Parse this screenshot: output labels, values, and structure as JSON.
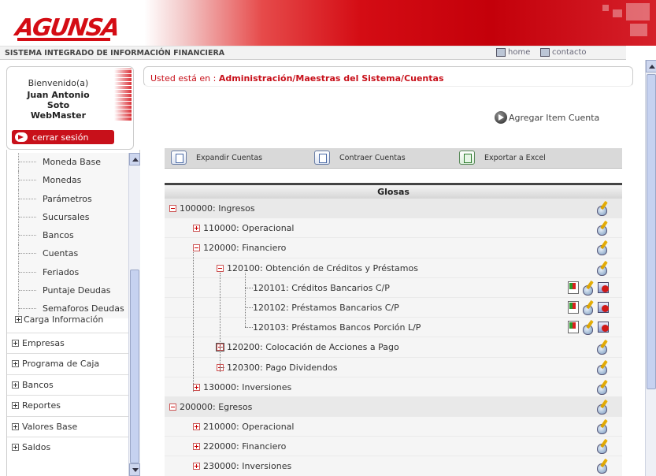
{
  "header": {
    "logo": "AGUNSA",
    "system_title": "SISTEMA INTEGRADO DE INFORMACIÓN FINANCIERA",
    "home_label": "home",
    "contact_label": "contacto"
  },
  "welcome": {
    "greeting": "Bienvenido(a)",
    "name": "Juan Antonio Soto",
    "role": "WebMaster",
    "logout_label": "cerrar sesión"
  },
  "sidebar": {
    "sub_items": [
      "Moneda Base",
      "Monedas",
      "Parámetros",
      "Sucursales",
      "Bancos",
      "Cuentas",
      "Feriados",
      "Puntaje Deudas",
      "Semaforos Deudas"
    ],
    "carga_label": "Carga Información",
    "menus": [
      "Empresas",
      "Programa de Caja",
      "Bancos",
      "Reportes",
      "Valores Base",
      "Saldos"
    ]
  },
  "breadcrumb": {
    "prefix": "Usted está en :",
    "path": "Administración/Maestras del Sistema/Cuentas"
  },
  "add_item_label": "Agregar Item Cuenta",
  "toolbar": {
    "expand_label": "Expandir Cuentas",
    "collapse_label": "Contraer Cuentas",
    "export_label": "Exportar a Excel"
  },
  "table": {
    "header": "Glosas",
    "rows": [
      {
        "label": "100000: Ingresos"
      },
      {
        "label": "110000: Operacional"
      },
      {
        "label": "120000: Financiero"
      },
      {
        "label": "120100: Obtención de Créditos y Préstamos"
      },
      {
        "label": "120101: Créditos Bancarios C/P"
      },
      {
        "label": "120102: Préstamos Bancarios C/P"
      },
      {
        "label": "120103: Préstamos Bancos Porción L/P"
      },
      {
        "label": "120200: Colocación de Acciones a Pago"
      },
      {
        "label": "120300: Pago Dividendos"
      },
      {
        "label": "130000: Inversiones"
      },
      {
        "label": "200000: Egresos"
      },
      {
        "label": "210000: Operacional"
      },
      {
        "label": "220000: Financiero"
      },
      {
        "label": "230000: Inversiones"
      }
    ]
  },
  "colors": {
    "brand_red": "#d40c14",
    "toolbar_gray": "#d9d9d9"
  }
}
